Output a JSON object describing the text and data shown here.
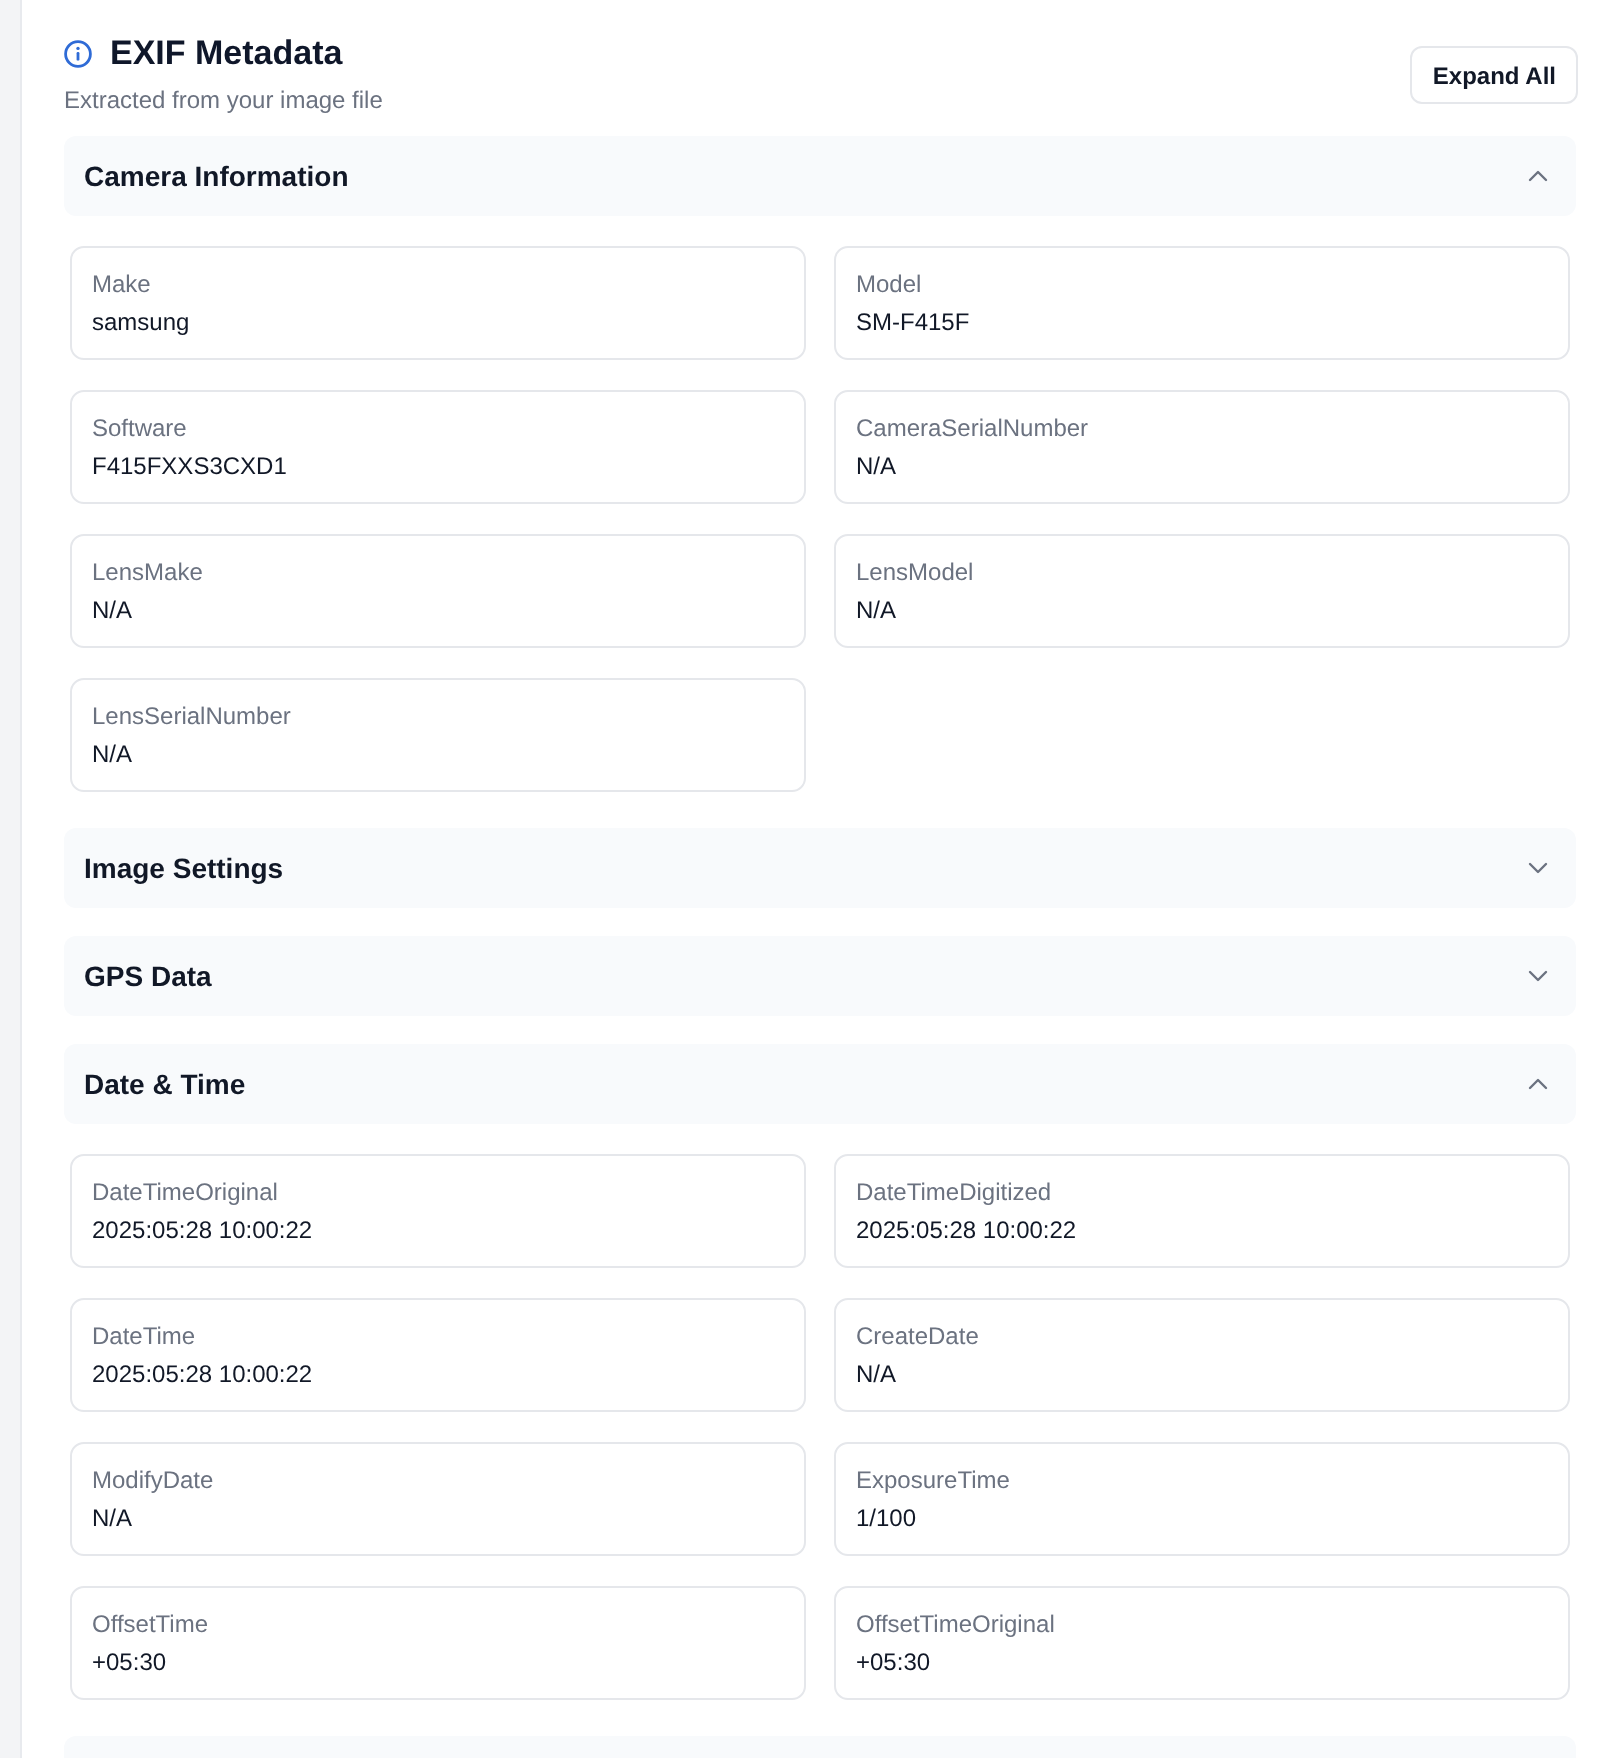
{
  "header": {
    "title": "EXIF Metadata",
    "subtitle": "Extracted from your image file",
    "expand_button": "Expand All"
  },
  "sections": [
    {
      "title": "Camera Information",
      "expanded": true,
      "fields": [
        {
          "label": "Make",
          "value": "samsung"
        },
        {
          "label": "Model",
          "value": "SM-F415F"
        },
        {
          "label": "Software",
          "value": "F415FXXS3CXD1"
        },
        {
          "label": "CameraSerialNumber",
          "value": "N/A"
        },
        {
          "label": "LensMake",
          "value": "N/A"
        },
        {
          "label": "LensModel",
          "value": "N/A"
        },
        {
          "label": "LensSerialNumber",
          "value": "N/A"
        }
      ]
    },
    {
      "title": "Image Settings",
      "expanded": false
    },
    {
      "title": "GPS Data",
      "expanded": false
    },
    {
      "title": "Date & Time",
      "expanded": true,
      "fields": [
        {
          "label": "DateTimeOriginal",
          "value": "2025:05:28 10:00:22"
        },
        {
          "label": "DateTimeDigitized",
          "value": "2025:05:28 10:00:22"
        },
        {
          "label": "DateTime",
          "value": "2025:05:28 10:00:22"
        },
        {
          "label": "CreateDate",
          "value": "N/A"
        },
        {
          "label": "ModifyDate",
          "value": "N/A"
        },
        {
          "label": "ExposureTime",
          "value": "1/100"
        },
        {
          "label": "OffsetTime",
          "value": "+05:30"
        },
        {
          "label": "OffsetTimeOriginal",
          "value": "+05:30"
        }
      ]
    }
  ]
}
